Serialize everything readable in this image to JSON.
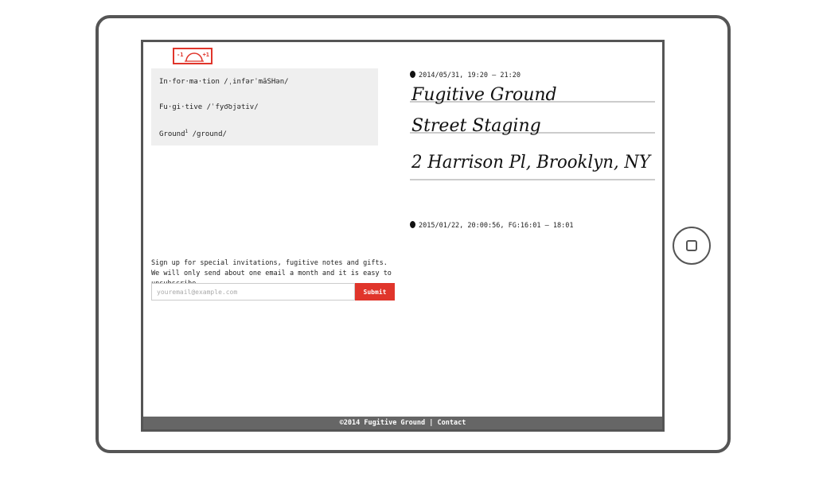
{
  "logo": {
    "minus": "-1",
    "plus": "+1"
  },
  "definitions": [
    {
      "word": "In·for·ma·tion",
      "pron": "/ˌinfərˈmāSHən/",
      "sup": ""
    },
    {
      "word": "Fu·gi·tive",
      "pron": "/ˈfyo͞ojətiv/",
      "sup": ""
    },
    {
      "word": "Ground",
      "pron": "/ground/",
      "sup": "1"
    }
  ],
  "signup": {
    "text": "Sign up for special invitations, fugitive notes and gifts. We will only send about one email a month and it is easy to unsubscribe.",
    "placeholder": "youremail@example.com",
    "submit_label": "Submit"
  },
  "events": [
    {
      "when": "2014/05/31, 19:20 – 21:20",
      "handwriting": [
        "Fugitive Ground",
        "Street Staging",
        "2 Harrison Pl, Brooklyn, NY"
      ]
    },
    {
      "when": "2015/01/22, 20:00:56, FG:16:01 – 18:01"
    }
  ],
  "footer": {
    "copyright": "©2014 Fugitive Ground",
    "separator": " | ",
    "contact": "Contact"
  }
}
